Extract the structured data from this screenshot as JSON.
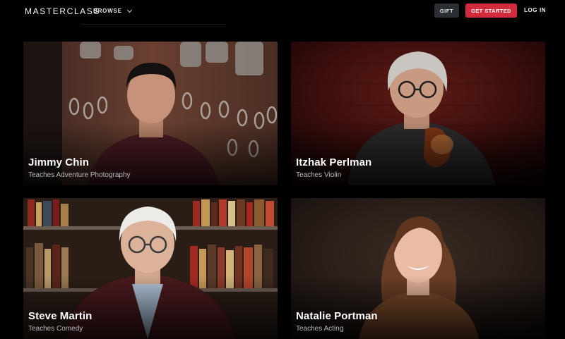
{
  "nav": {
    "logo": "MASTERCLASS",
    "browse_label": "BROWSE",
    "gift_label": "GIFT",
    "get_started_label": "GET STARTED",
    "login_label": "LOG IN"
  },
  "colors": {
    "background": "#000000",
    "accent_red": "#d22b3b",
    "gift_button": "#2b2f35",
    "subtitle_gray": "#b9b9b9"
  },
  "instructors": [
    {
      "name": "Jimmy Chin",
      "subtitle": "Teaches Adventure Photography"
    },
    {
      "name": "Itzhak Perlman",
      "subtitle": "Teaches Violin"
    },
    {
      "name": "Steve Martin",
      "subtitle": "Teaches Comedy"
    },
    {
      "name": "Natalie Portman",
      "subtitle": "Teaches Acting"
    }
  ]
}
